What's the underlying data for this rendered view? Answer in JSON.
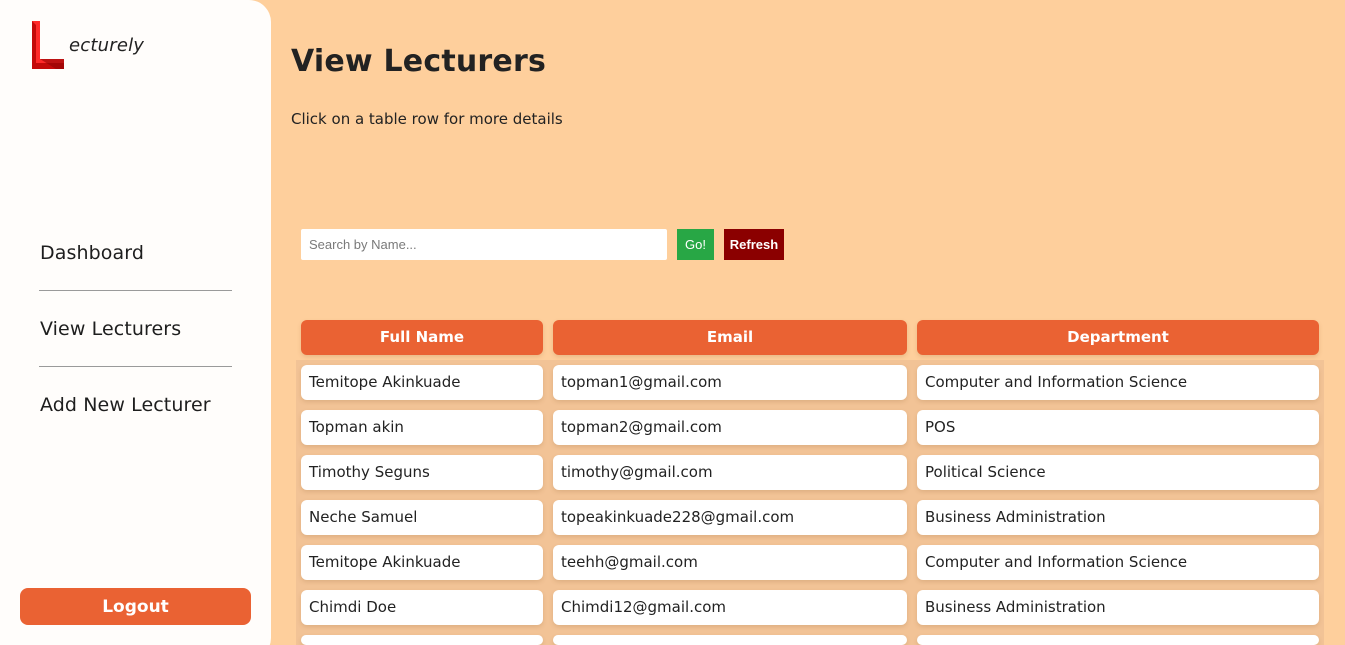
{
  "brand": {
    "name": "ecturely",
    "logo_letter": "L",
    "logo_color": "#d40d0d"
  },
  "nav": {
    "items": [
      {
        "label": "Dashboard"
      },
      {
        "label": "View Lecturers"
      },
      {
        "label": "Add New Lecturer"
      }
    ],
    "logout_label": "Logout"
  },
  "page": {
    "title": "View Lecturers",
    "hint": "Click on a table row for more details"
  },
  "search": {
    "placeholder": "Search by Name...",
    "value": "",
    "go_label": "Go!",
    "refresh_label": "Refresh"
  },
  "table": {
    "headers": [
      "Full Name",
      "Email",
      "Department"
    ],
    "rows": [
      [
        "Temitope Akinkuade",
        "topman1@gmail.com",
        "Computer and Information Science"
      ],
      [
        "Topman akin",
        "topman2@gmail.com",
        "POS"
      ],
      [
        "Timothy Seguns",
        "timothy@gmail.com",
        "Political Science"
      ],
      [
        "Neche Samuel",
        "topeakinkuade228@gmail.com",
        "Business Administration"
      ],
      [
        "Temitope Akinkuade",
        "teehh@gmail.com",
        "Computer and Information Science"
      ],
      [
        "Chimdi Doe",
        "Chimdi12@gmail.com",
        "Business Administration"
      ],
      [
        "",
        "",
        ""
      ]
    ]
  },
  "colors": {
    "background": "#fecf9c",
    "accent": "#ea6233",
    "go": "#28a745",
    "refresh": "#8b0000"
  }
}
